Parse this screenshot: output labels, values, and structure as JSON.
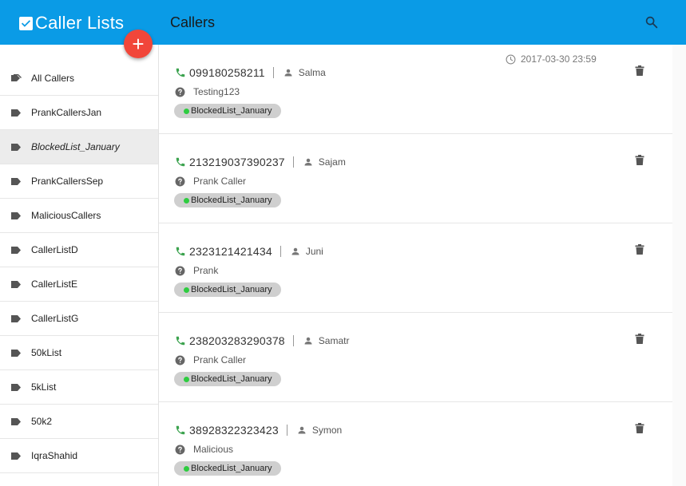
{
  "header": {
    "app_title": "Caller Lists",
    "page_title": "Callers",
    "add_label": "+",
    "accent_color": "#0a9be6",
    "fab_color": "#f1463a"
  },
  "sidebar": {
    "items": [
      {
        "label": "All Callers",
        "icon": "tags-icon"
      },
      {
        "label": "PrankCallersJan",
        "icon": "tag-icon"
      },
      {
        "label": "BlockedList_January",
        "icon": "tag-icon",
        "active": true
      },
      {
        "label": "PrankCallersSep",
        "icon": "tag-icon"
      },
      {
        "label": "MaliciousCallers",
        "icon": "tag-icon"
      },
      {
        "label": "CallerListD",
        "icon": "tag-icon"
      },
      {
        "label": "CallerListE",
        "icon": "tag-icon"
      },
      {
        "label": "CallerListG",
        "icon": "tag-icon"
      },
      {
        "label": "50kList",
        "icon": "tag-icon"
      },
      {
        "label": "5kList",
        "icon": "tag-icon"
      },
      {
        "label": "50k2",
        "icon": "tag-icon"
      },
      {
        "label": "IqraShahid",
        "icon": "tag-icon"
      }
    ]
  },
  "callers": [
    {
      "phone": "099180258211",
      "name": "Salma",
      "note": "Testing123",
      "list": "BlockedList_January",
      "timestamp": "2017-03-30 23:59"
    },
    {
      "phone": "213219037390237",
      "name": "Sajam",
      "note": "Prank Caller",
      "list": "BlockedList_January"
    },
    {
      "phone": "2323121421434",
      "name": "Juni",
      "note": "Prank",
      "list": "BlockedList_January"
    },
    {
      "phone": "238203283290378",
      "name": "Samatr",
      "note": "Prank Caller",
      "list": "BlockedList_January"
    },
    {
      "phone": "38928322323423",
      "name": "Symon",
      "note": "Malicious",
      "list": "BlockedList_January"
    }
  ],
  "colors": {
    "phone_icon": "#3ca34f",
    "chip_dot": "#2ecc40",
    "chip_bg": "#cfcfcf"
  }
}
